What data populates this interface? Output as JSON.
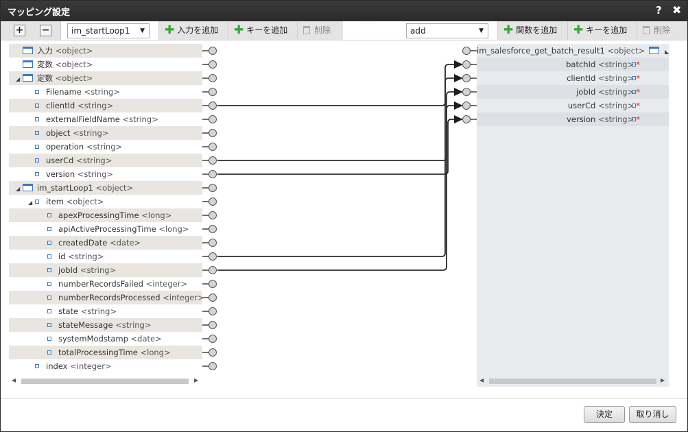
{
  "window": {
    "title": "マッピング設定",
    "help": "?",
    "close": "✖"
  },
  "toolbar": {
    "expand": "+",
    "collapse": "−",
    "left_select": "im_startLoop1",
    "add_input": "入力を追加",
    "add_key_left": "キーを追加",
    "delete_left": "削除",
    "right_select": "add",
    "add_function": "関数を追加",
    "add_key_right": "キーを追加",
    "delete_right": "削除"
  },
  "left_tree": [
    {
      "name": "入力",
      "type": "<object>",
      "indent": 0,
      "icon": "object",
      "twisty": ""
    },
    {
      "name": "変数",
      "type": "<object>",
      "indent": 0,
      "icon": "object",
      "twisty": ""
    },
    {
      "name": "定数",
      "type": "<object>",
      "indent": 0,
      "icon": "object",
      "twisty": "◢"
    },
    {
      "name": "Filename",
      "type": "<string>",
      "indent": 1,
      "icon": "leaf",
      "twisty": ""
    },
    {
      "name": "clientId",
      "type": "<string>",
      "indent": 1,
      "icon": "leaf",
      "twisty": ""
    },
    {
      "name": "externalFieldName",
      "type": "<string>",
      "indent": 1,
      "icon": "leaf",
      "twisty": ""
    },
    {
      "name": "object",
      "type": "<string>",
      "indent": 1,
      "icon": "leaf",
      "twisty": ""
    },
    {
      "name": "operation",
      "type": "<string>",
      "indent": 1,
      "icon": "leaf",
      "twisty": ""
    },
    {
      "name": "userCd",
      "type": "<string>",
      "indent": 1,
      "icon": "leaf",
      "twisty": ""
    },
    {
      "name": "version",
      "type": "<string>",
      "indent": 1,
      "icon": "leaf",
      "twisty": ""
    },
    {
      "name": "im_startLoop1",
      "type": "<object>",
      "indent": 0,
      "icon": "object",
      "twisty": "◢"
    },
    {
      "name": "item",
      "type": "<object>",
      "indent": 1,
      "icon": "leaf",
      "twisty": "◢"
    },
    {
      "name": "apexProcessingTime",
      "type": "<long>",
      "indent": 2,
      "icon": "leaf",
      "twisty": ""
    },
    {
      "name": "apiActiveProcessingTime",
      "type": "<long>",
      "indent": 2,
      "icon": "leaf",
      "twisty": ""
    },
    {
      "name": "createdDate",
      "type": "<date>",
      "indent": 2,
      "icon": "leaf",
      "twisty": ""
    },
    {
      "name": "id",
      "type": "<string>",
      "indent": 2,
      "icon": "leaf",
      "twisty": ""
    },
    {
      "name": "jobId",
      "type": "<string>",
      "indent": 2,
      "icon": "leaf",
      "twisty": ""
    },
    {
      "name": "numberRecordsFailed",
      "type": "<integer>",
      "indent": 2,
      "icon": "leaf",
      "twisty": ""
    },
    {
      "name": "numberRecordsProcessed",
      "type": "<integer>",
      "indent": 2,
      "icon": "leaf",
      "twisty": ""
    },
    {
      "name": "state",
      "type": "<string>",
      "indent": 2,
      "icon": "leaf",
      "twisty": ""
    },
    {
      "name": "stateMessage",
      "type": "<string>",
      "indent": 2,
      "icon": "leaf",
      "twisty": ""
    },
    {
      "name": "systemModstamp",
      "type": "<date>",
      "indent": 2,
      "icon": "leaf",
      "twisty": ""
    },
    {
      "name": "totalProcessingTime",
      "type": "<long>",
      "indent": 2,
      "icon": "leaf",
      "twisty": ""
    },
    {
      "name": "index",
      "type": "<integer>",
      "indent": 1,
      "icon": "leaf",
      "twisty": ""
    }
  ],
  "right_tree": [
    {
      "name": "im_salesforce_get_batch_result1",
      "type": "<object>",
      "required": ""
    },
    {
      "name": "batchId",
      "type": "<string>",
      "required": "*"
    },
    {
      "name": "clientId",
      "type": "<string>",
      "required": "*"
    },
    {
      "name": "jobId",
      "type": "<string>",
      "required": "*"
    },
    {
      "name": "userCd",
      "type": "<string>",
      "required": "*"
    },
    {
      "name": "version",
      "type": "<string>",
      "required": "*"
    }
  ],
  "mappings": [
    {
      "from": 4,
      "to": 2
    },
    {
      "from": 8,
      "to": 4
    },
    {
      "from": 9,
      "to": 5
    },
    {
      "from": 15,
      "to": 1
    },
    {
      "from": 16,
      "to": 3
    }
  ],
  "footer": {
    "ok": "決定",
    "cancel": "取り消し"
  },
  "colors": {
    "titlebar": "#2b2b2b",
    "accent": "#3a78c4",
    "add": "#33a933",
    "required": "#d22222"
  }
}
